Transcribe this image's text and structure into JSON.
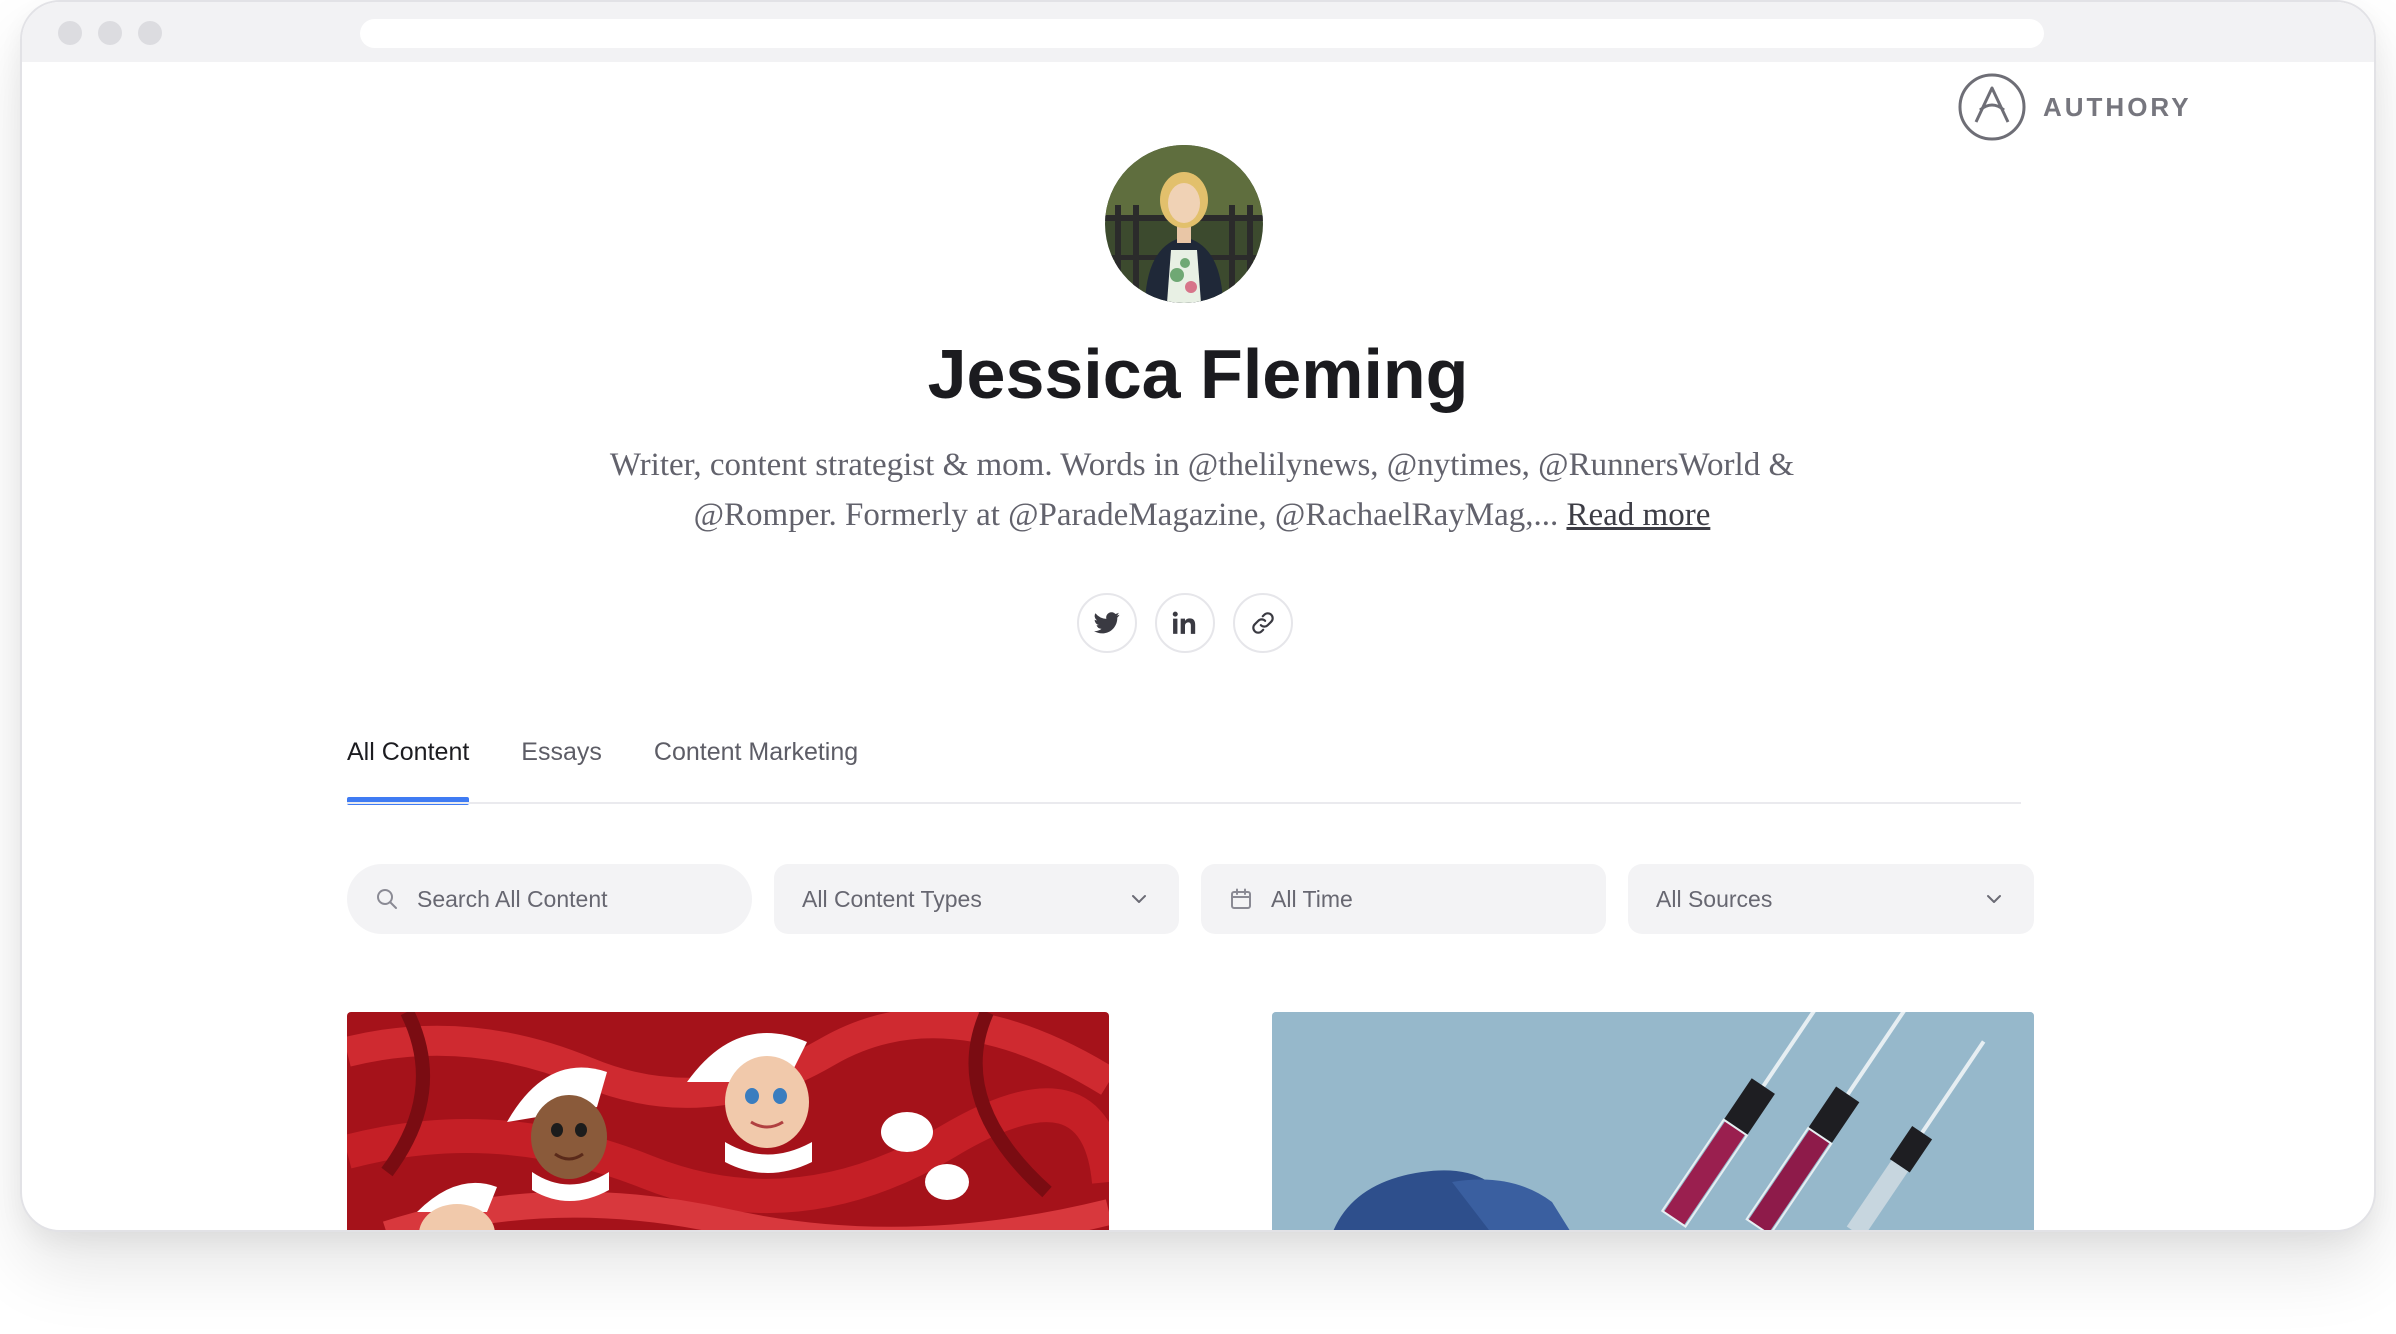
{
  "brand": {
    "name": "AUTHORY",
    "logo_icon": "authory-logo-icon"
  },
  "profile": {
    "name": "Jessica Fleming",
    "bio": "Writer, content strategist & mom. Words in @thelilynews, @nytimes, @RunnersWorld & @Romper. Formerly at @ParadeMagazine, @RachaelRayMag,...",
    "read_more": "Read more",
    "avatar": "profile-photo"
  },
  "socials": [
    {
      "icon": "twitter-icon"
    },
    {
      "icon": "linkedin-icon"
    },
    {
      "icon": "link-icon"
    }
  ],
  "tabs": [
    {
      "label": "All Content",
      "active": true
    },
    {
      "label": "Essays",
      "active": false
    },
    {
      "label": "Content Marketing",
      "active": false
    }
  ],
  "filters": {
    "search_placeholder": "Search All Content",
    "content_types": "All Content Types",
    "time": "All Time",
    "sources": "All Sources"
  },
  "colors": {
    "accent": "#3f7bf3",
    "text_dark": "#1b1b1f",
    "text_muted": "#62626c",
    "filter_bg": "#f3f3f5"
  },
  "cards": [
    {
      "image": "elf-dolls-photo"
    },
    {
      "image": "syringes-photo"
    }
  ]
}
